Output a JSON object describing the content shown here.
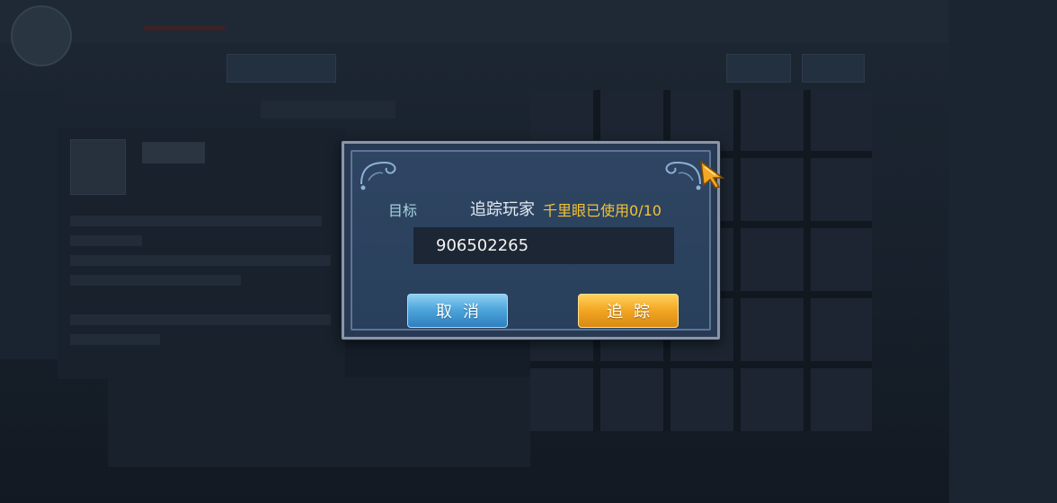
{
  "dialog": {
    "target_label": "目标",
    "title": "追踪玩家",
    "usage_text": "千里眼已使用0/10",
    "input_value": "906502265",
    "cancel_label": "取消",
    "track_label": "追踪"
  },
  "colors": {
    "usage_gold": "#f2c433",
    "cancel_blue": "#4ea6dc",
    "track_orange": "#f3a623",
    "dialog_bg": "#283a53"
  },
  "icons": {
    "corner_decor": "ornament-icon",
    "cursor": "arrow-cursor-icon"
  }
}
